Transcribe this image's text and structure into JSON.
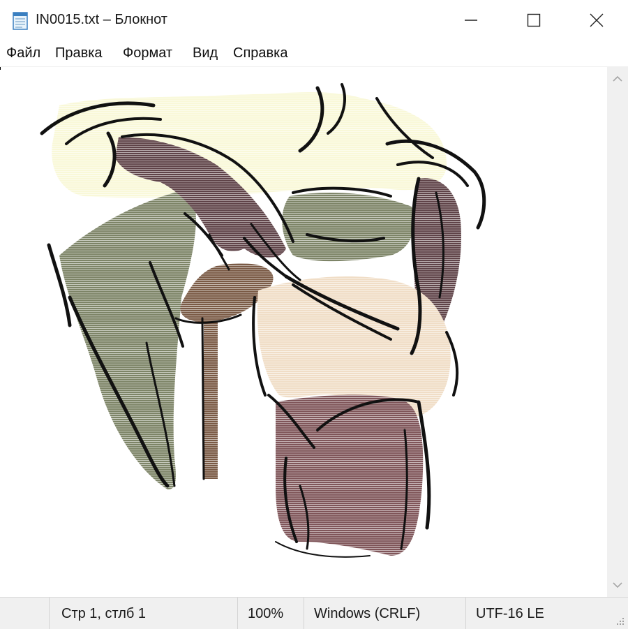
{
  "window": {
    "title": "IN0015.txt – Блокнот"
  },
  "menu": {
    "items": [
      "Файл",
      "Правка",
      "Формат",
      "Вид",
      "Справка"
    ]
  },
  "editor": {
    "content_type": "ascii-art illustration rendered as colored text"
  },
  "status": {
    "position": "Стр 1, стлб 1",
    "zoom": "100%",
    "line_ending": "Windows (CRLF)",
    "encoding": "UTF-16 LE"
  },
  "colors": {
    "olive": "#7d8467",
    "dark_brown": "#5f4348",
    "wood": "#7a5a45",
    "cream": "#f9f8d8",
    "peach": "#f0ddc6",
    "mauve": "#7f5559",
    "outline": "#111111"
  }
}
